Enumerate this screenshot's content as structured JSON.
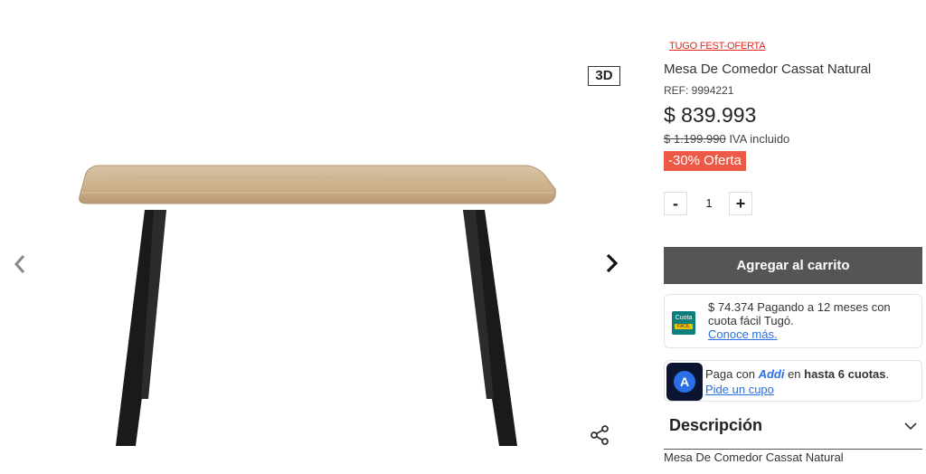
{
  "gallery": {
    "badge_3d": "3D",
    "prev_icon": "chevron-left-icon",
    "next_icon": "chevron-right-icon",
    "share_icon": "share-icon",
    "image_subject": "dining-table-image"
  },
  "product": {
    "promo_label": "TUGO FEST-OFERTA",
    "title": "Mesa De Comedor Cassat Natural",
    "ref": "REF: 9994221",
    "price": "$ 839.993",
    "old_price": "$ 1.199.990",
    "iva_label": "IVA incluido",
    "discount_badge": "-30% Oferta"
  },
  "quantity": {
    "minus": "-",
    "value": "1",
    "plus": "+"
  },
  "cart_button": "Agregar al carrito",
  "financing": {
    "cuota_logo_top": "Cuota",
    "cuota_logo_bottom": "FÁCIL",
    "text": "$ 74.374 Pagando a 12 meses con cuota fácil Tugó.",
    "link": "Conoce más."
  },
  "addi": {
    "logo_letter": "A",
    "prefix": "Paga con",
    "brand": "Addi",
    "middle": "en",
    "bold": "hasta 6 cuotas",
    "suffix": ".",
    "link": "Pide un cupo"
  },
  "description": {
    "heading": "Descripción",
    "chevron_icon": "chevron-down-icon",
    "text": "Mesa De Comedor Cassat Natural"
  },
  "colors": {
    "accent_red": "#e0251b",
    "discount_bg": "#ec5a47",
    "cart_bg": "#555555",
    "link_blue": "#2a6fdb"
  }
}
